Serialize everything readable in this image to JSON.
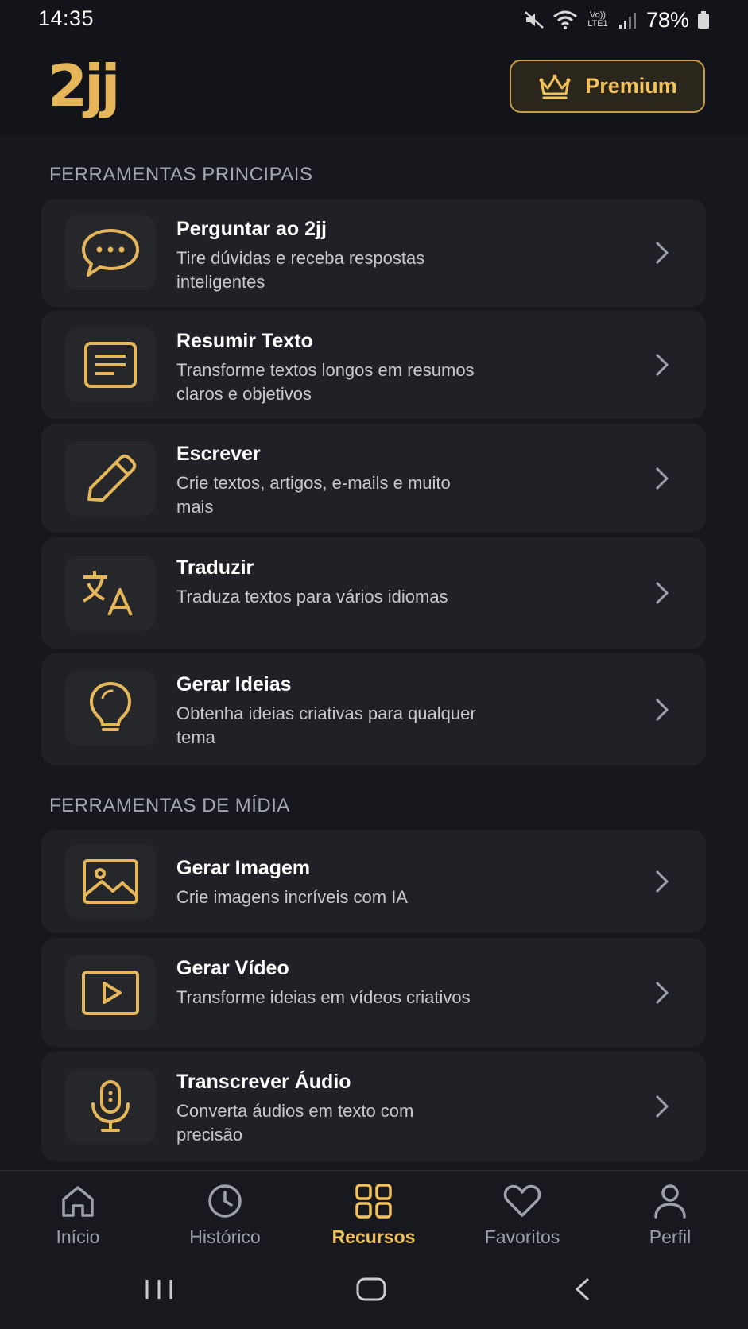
{
  "status": {
    "time": "14:35",
    "network": "Vo)) LTE1",
    "battery": "78%"
  },
  "header": {
    "logo": "2jj",
    "premium_label": "Premium"
  },
  "sections": {
    "main_title": "FERRAMENTAS PRINCIPAIS",
    "media_title": "FERRAMENTAS DE MÍDIA"
  },
  "tools": [
    {
      "title": "Perguntar ao 2jj",
      "desc": "Tire dúvidas e receba respostas inteligentes",
      "icon": "chat-icon"
    },
    {
      "title": "Resumir Texto",
      "desc": "Transforme textos longos em resumos claros e objetivos",
      "icon": "document-icon"
    },
    {
      "title": "Escrever",
      "desc": "Crie textos, artigos, e-mails e muito mais",
      "icon": "pencil-icon"
    },
    {
      "title": "Traduzir",
      "desc": "Traduza textos para vários idiomas",
      "icon": "translate-icon"
    },
    {
      "title": "Gerar Ideias",
      "desc": "Obtenha ideias criativas para qualquer tema",
      "icon": "lightbulb-icon"
    }
  ],
  "media": [
    {
      "title": "Gerar Imagem",
      "desc": "Crie imagens incríveis com IA",
      "icon": "image-icon"
    },
    {
      "title": "Gerar Vídeo",
      "desc": "Transforme ideias em vídeos criativos",
      "icon": "video-icon"
    },
    {
      "title": "Transcrever Áudio",
      "desc": "Converta áudios em texto com precisão",
      "icon": "microphone-icon"
    }
  ],
  "nav": [
    {
      "label": "Início",
      "icon": "home-icon"
    },
    {
      "label": "Histórico",
      "icon": "clock-icon"
    },
    {
      "label": "Recursos",
      "icon": "grid-icon",
      "active": true
    },
    {
      "label": "Favoritos",
      "icon": "heart-icon"
    },
    {
      "label": "Perfil",
      "icon": "user-icon"
    }
  ],
  "colors": {
    "accent": "#f1c15c",
    "background": "#16181d",
    "card": "#1f2126"
  }
}
